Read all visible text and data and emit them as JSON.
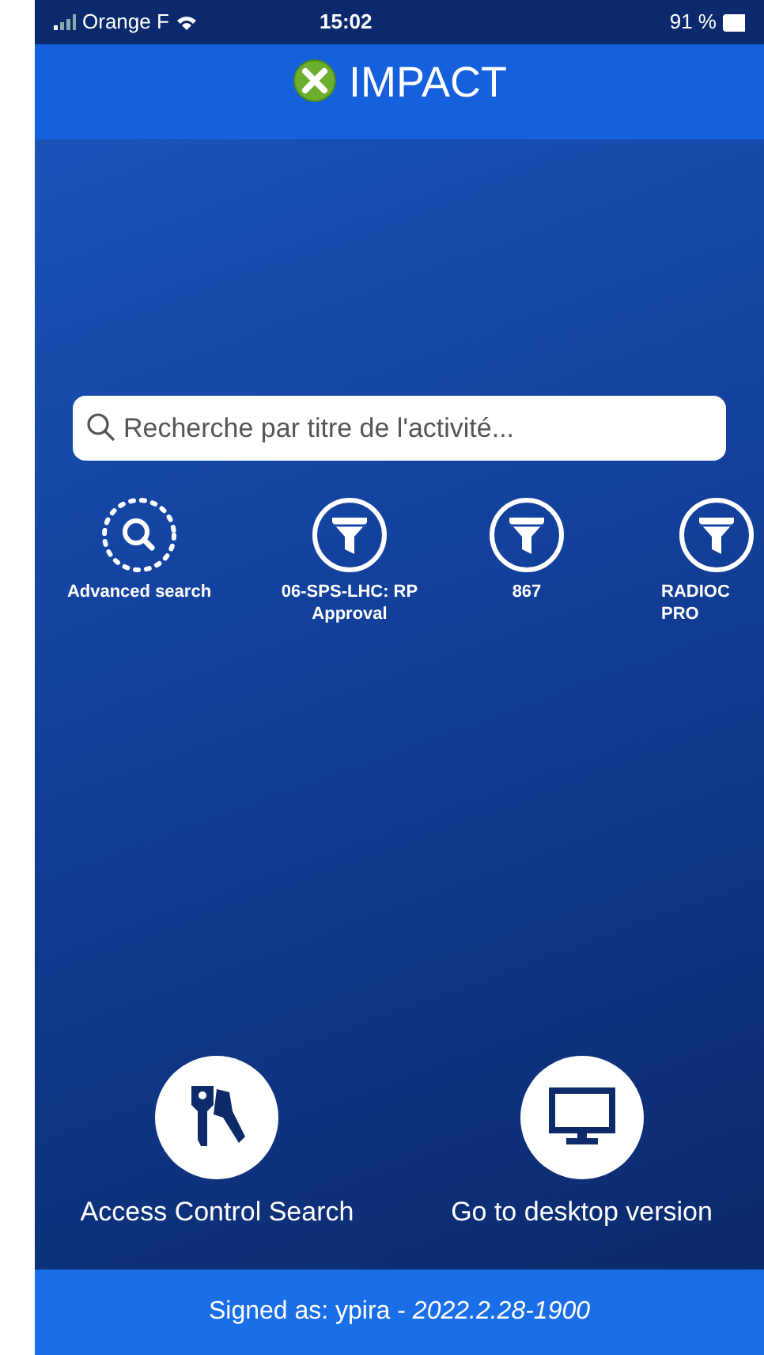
{
  "status_bar": {
    "carrier": "Orange F",
    "time": "15:02",
    "battery": "91 %"
  },
  "header": {
    "title": "IMPACT"
  },
  "search": {
    "placeholder": "Recherche par titre de l'activité..."
  },
  "shortcuts": [
    {
      "kind": "advanced",
      "label": "Advanced search"
    },
    {
      "kind": "filter",
      "label": "06-SPS-LHC: RP Approval"
    },
    {
      "kind": "filter",
      "label": "867"
    },
    {
      "kind": "filter",
      "label": "RADIOC PRO"
    }
  ],
  "actions": [
    {
      "kind": "keys",
      "label": "Access Control Search"
    },
    {
      "kind": "desktop",
      "label": "Go to desktop version"
    }
  ],
  "footer": {
    "text": "Signed as: ypira - *2022.2.28-1900*"
  }
}
